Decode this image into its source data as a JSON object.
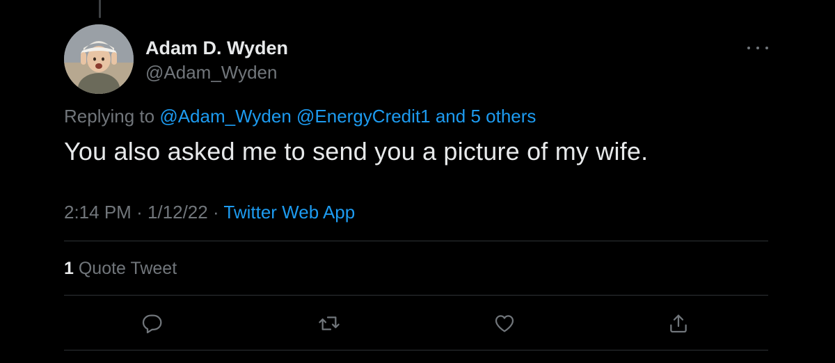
{
  "tweet": {
    "author": {
      "display_name": "Adam D. Wyden",
      "handle": "@Adam_Wyden"
    },
    "reply_context": {
      "prefix": "Replying to",
      "mentions": [
        "@Adam_Wyden",
        "@EnergyCredit1"
      ],
      "others_text": "and 5 others"
    },
    "text": "You also asked me to send you a picture of my wife.",
    "meta": {
      "time": "2:14 PM",
      "separator": "·",
      "date": "1/12/22",
      "source": "Twitter Web App"
    },
    "stats": {
      "quote_count": "1",
      "quote_label": "Quote Tweet"
    },
    "actions": {
      "reply_icon": "reply-icon",
      "retweet_icon": "retweet-icon",
      "like_icon": "like-icon",
      "share_icon": "share-icon"
    }
  },
  "colors": {
    "background": "#000000",
    "primary_text": "#e7e9ea",
    "secondary_text": "#71767b",
    "link": "#1d9bf0",
    "divider": "#2f3336"
  }
}
